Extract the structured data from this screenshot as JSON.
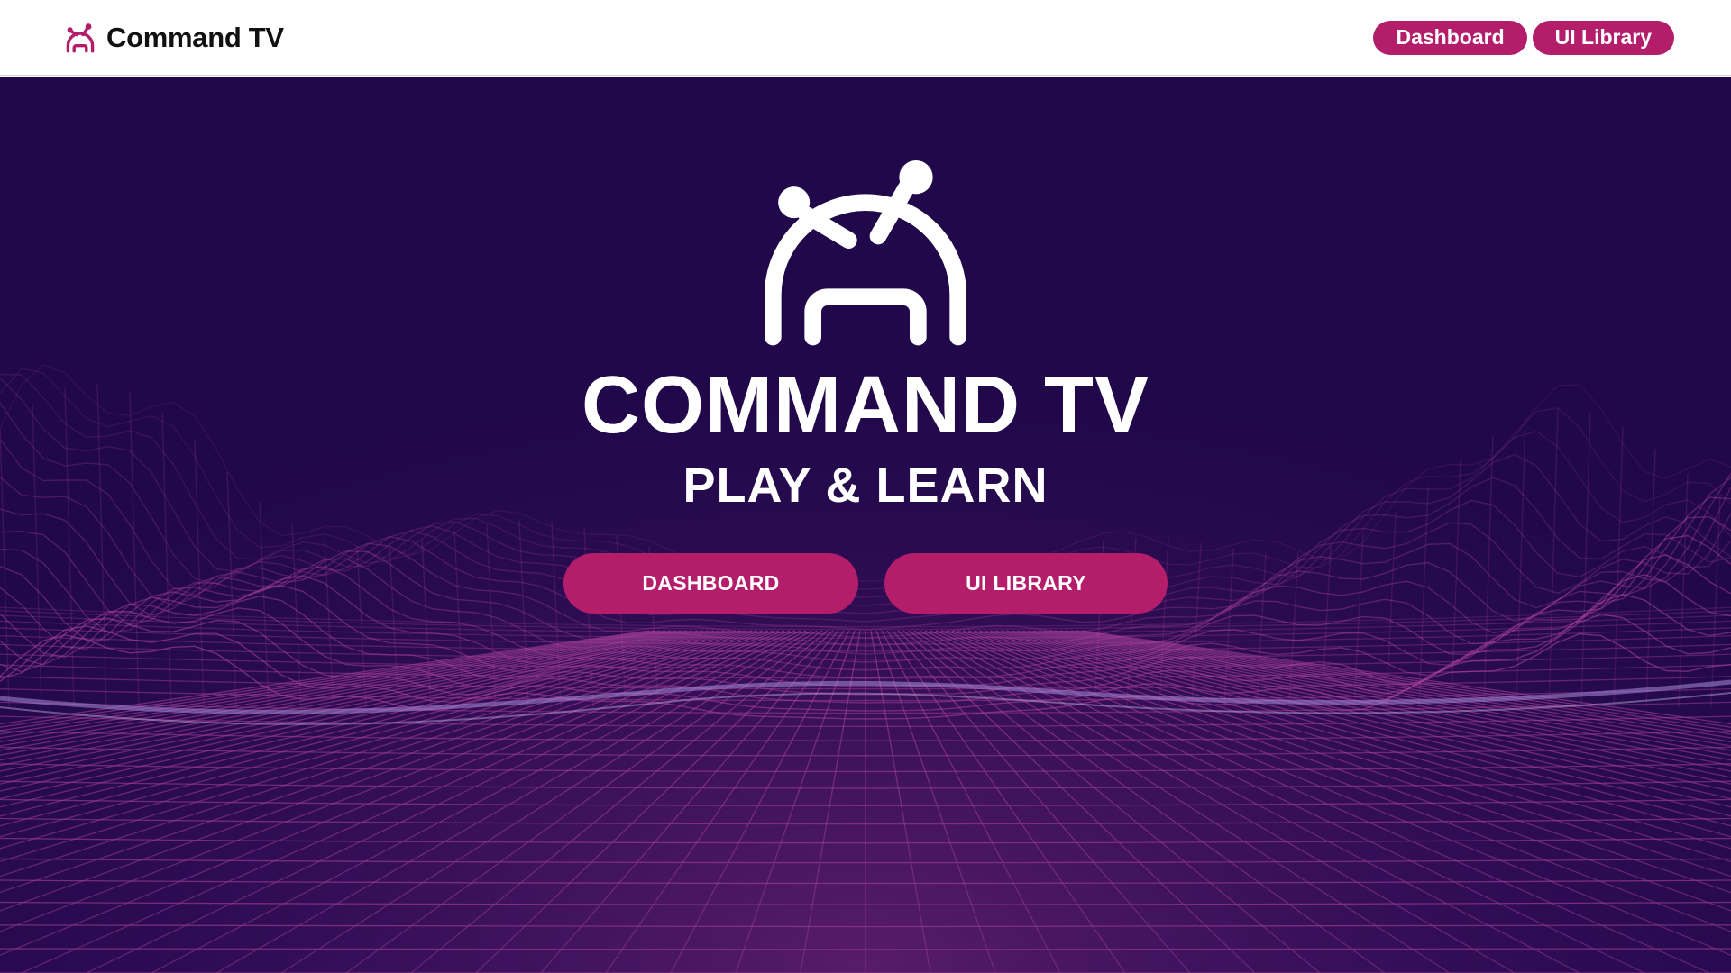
{
  "header": {
    "brand_name": "Command TV",
    "brand_icon": "robot-tv-logo-icon",
    "nav": [
      {
        "label": "Dashboard"
      },
      {
        "label": "UI Library"
      }
    ]
  },
  "hero": {
    "logo_icon": "robot-tv-logo-icon",
    "title": "COMMAND TV",
    "subtitle": "PLAY & LEARN",
    "buttons": [
      {
        "label": "DASHBOARD"
      },
      {
        "label": "UI LIBRARY"
      }
    ]
  },
  "colors": {
    "accent": "#b41d6a",
    "hero_background": "#20084a",
    "grid_lines": "#c04aa6",
    "text_light": "#ffffff",
    "text_dark": "#111111"
  }
}
